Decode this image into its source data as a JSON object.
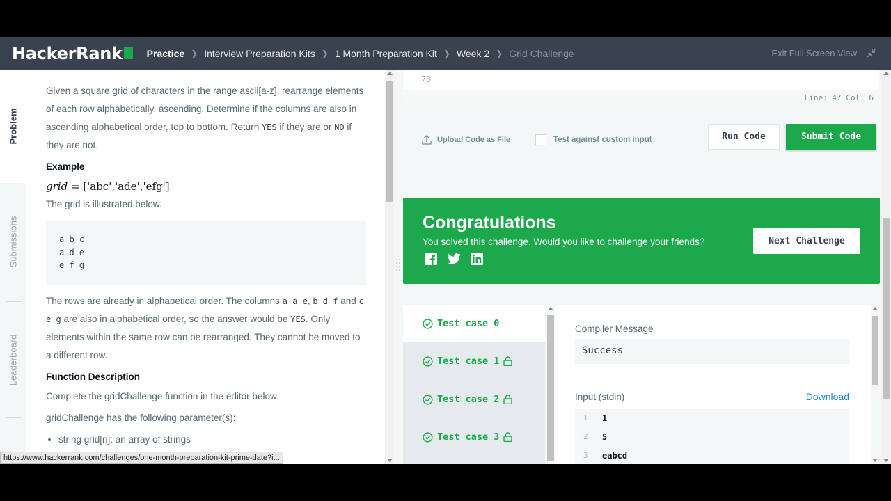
{
  "header": {
    "logo_text": "HackerRank",
    "breadcrumbs": [
      "Practice",
      "Interview Preparation Kits",
      "1 Month Preparation Kit",
      "Week 2",
      "Grid Challenge"
    ],
    "exit_fullscreen": "Exit Full Screen View"
  },
  "sidebar": {
    "tabs": [
      {
        "label": "Problem",
        "active": true
      },
      {
        "label": "Submissions",
        "active": false
      },
      {
        "label": "Leaderboard",
        "active": false
      }
    ]
  },
  "problem": {
    "intro_1": "Given a square grid of characters in the range ascii[a-z], rearrange elements of each row alphabetically, ascending. Determine if the columns are also in ascending alphabetical order, top to bottom. Return ",
    "yes": "YES",
    "intro_2": " if they are or ",
    "no": "NO",
    "intro_3": " if they are not.",
    "example_heading": "Example",
    "example_var": "grid",
    "example_eq": " = ['abc','ade','efg']",
    "illustrated": "The grid is illustrated below.",
    "grid_lines": [
      "a b c",
      "a d e",
      "e f g"
    ],
    "expl_1": "The rows are already in alphabetical order. The columns ",
    "col_1": "a a e",
    "comma": ", ",
    "col_2": "b d f",
    "and": " and ",
    "col_3": "c e g",
    "expl_2": " are also in alphabetical order, so the answer would be ",
    "expl_yes": "YES",
    "expl_3": ". Only elements within the same row can be rearranged. They cannot be moved to a different row.",
    "func_heading": "Function Description",
    "func_desc": "Complete the gridChallenge function in the editor below.",
    "params_intro": "gridChallenge has the following parameter(s):",
    "param_1": "string grid[n]: an array of strings"
  },
  "statusbar": "https://www.hackerrank.com/challenges/one-month-preparation-kit-prime-date?i...",
  "editor": {
    "last_line_number": "73",
    "cursor_status": "Line: 47 Col: 6",
    "upload_label": "Upload Code as File",
    "custom_input_label": "Test against custom input",
    "run_label": "Run Code",
    "submit_label": "Submit Code"
  },
  "congrats": {
    "title": "Congratulations",
    "message": "You solved this challenge. Would you like to challenge your friends?",
    "next_label": "Next Challenge",
    "social": [
      "facebook-icon",
      "twitter-icon",
      "linkedin-icon"
    ]
  },
  "test_cases": [
    {
      "label": "Test case 0",
      "locked": false,
      "active": true
    },
    {
      "label": "Test case 1",
      "locked": true,
      "active": false
    },
    {
      "label": "Test case 2",
      "locked": true,
      "active": false
    },
    {
      "label": "Test case 3",
      "locked": true,
      "active": false
    }
  ],
  "result": {
    "compiler_label": "Compiler Message",
    "compiler_value": "Success",
    "input_label": "Input (stdin)",
    "download_label": "Download",
    "stdin_lines": [
      {
        "n": "1",
        "text": "1"
      },
      {
        "n": "2",
        "text": "5"
      },
      {
        "n": "3",
        "text": "eabcd"
      }
    ]
  },
  "colors": {
    "brand_green": "#1ba94c",
    "header_bg": "#39424e",
    "link_blue": "#1f87c8"
  }
}
